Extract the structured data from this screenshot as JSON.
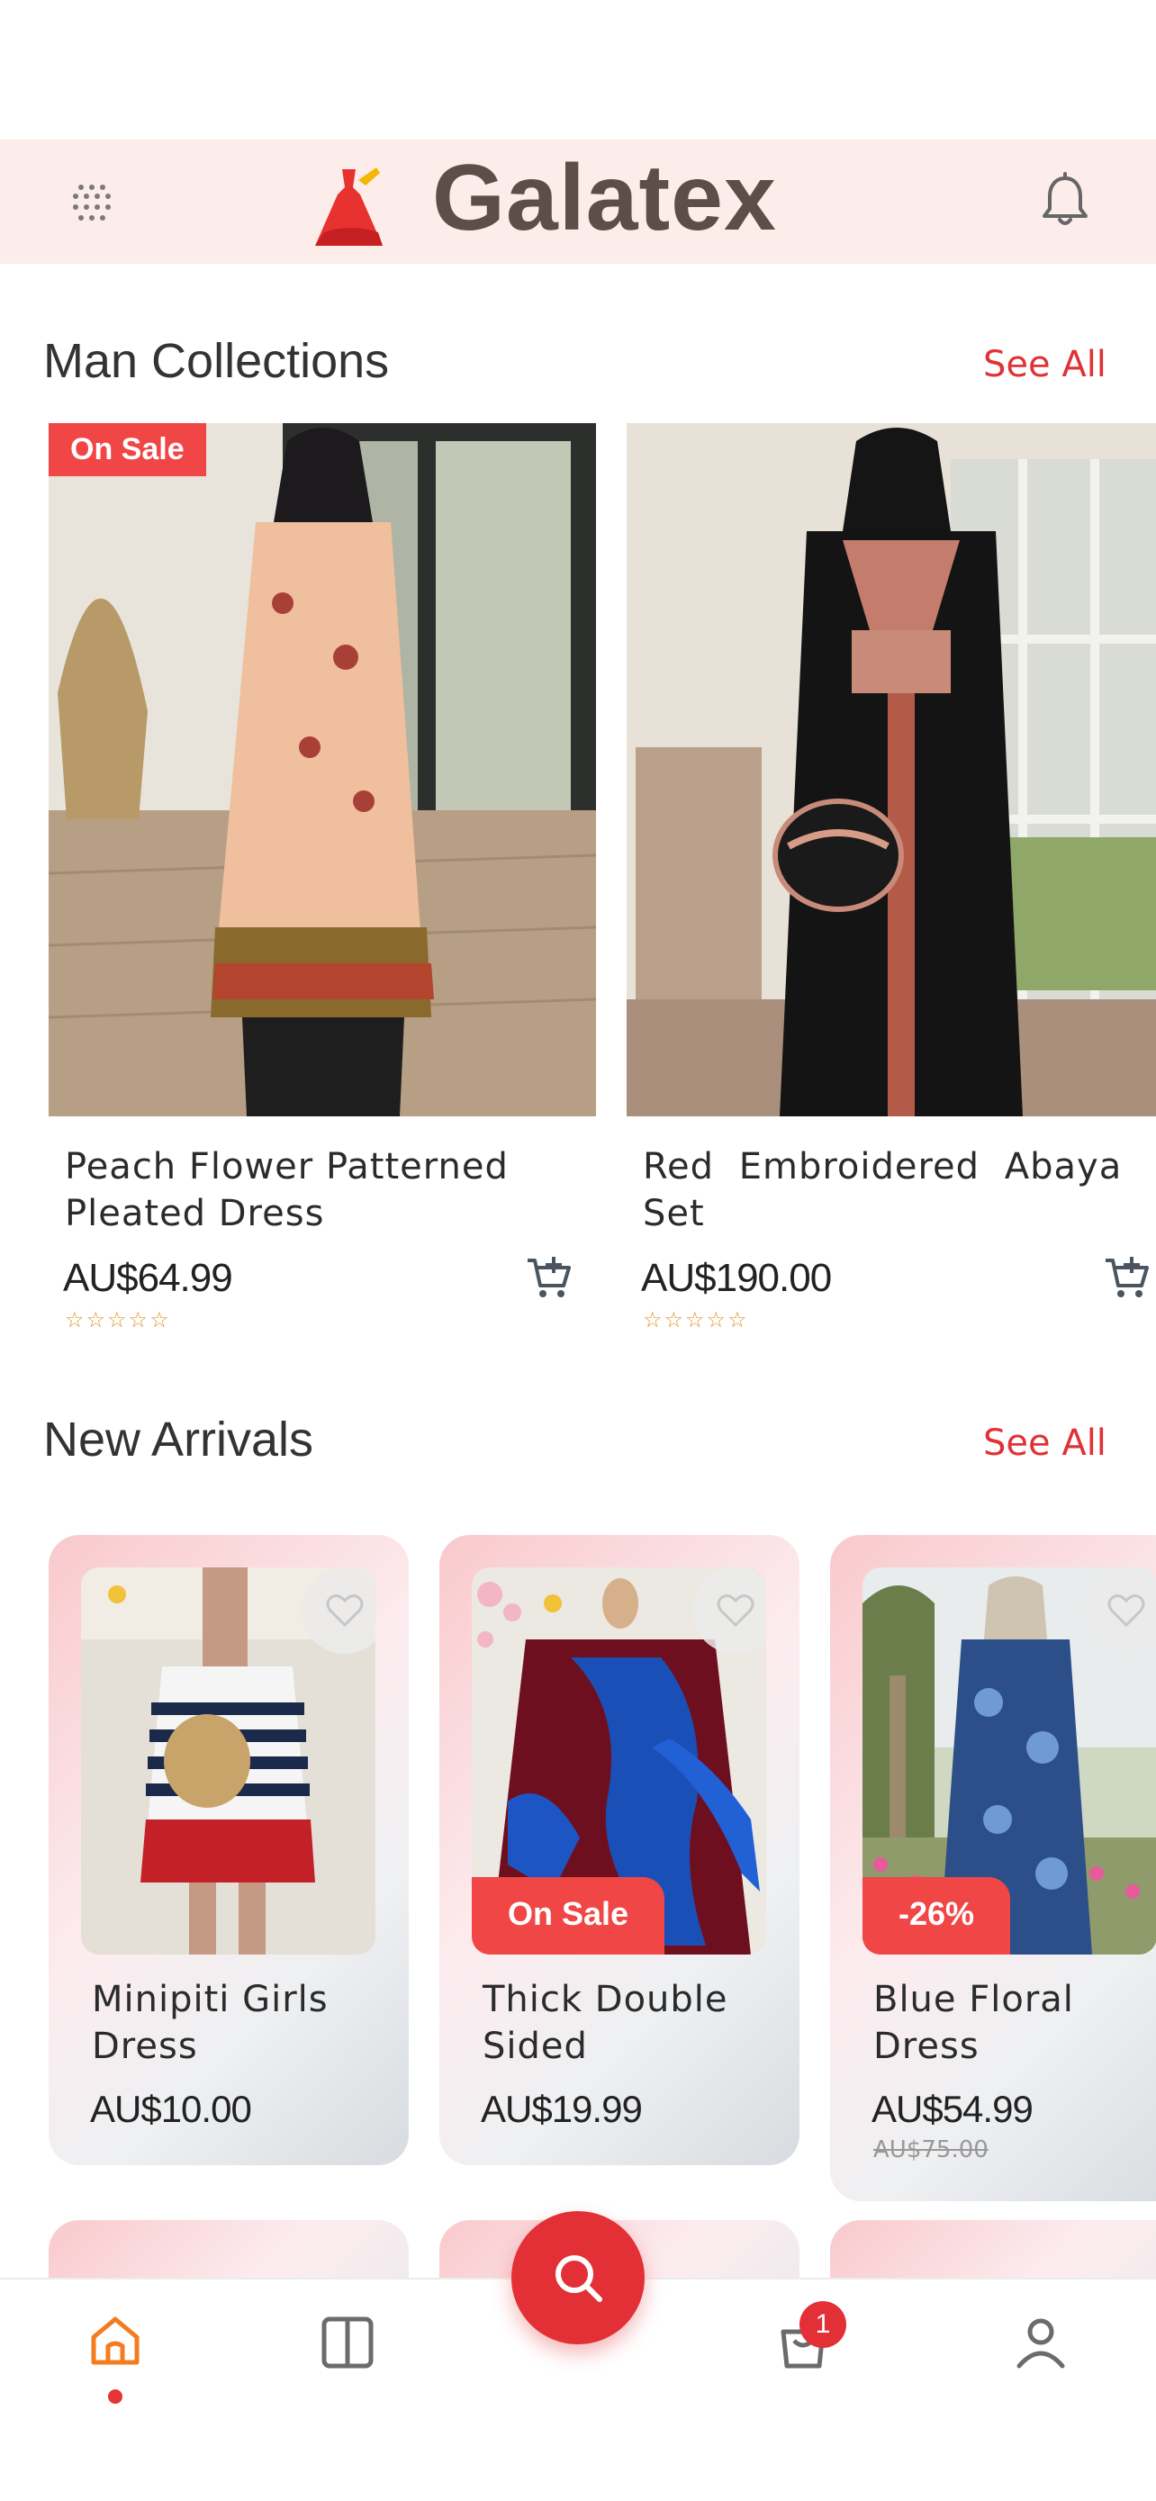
{
  "header": {
    "brand": "Galatex",
    "colors": {
      "bar": "#fcecea",
      "brand_text": "#5e4d49",
      "accent": "#e23036"
    }
  },
  "man_collections": {
    "title": "Man Collections",
    "see_all": "See All",
    "products": [
      {
        "badge": "On Sale",
        "name": "Peach Flower Patterned Pleated Dress",
        "price": "AU$64.99",
        "rating": 0,
        "stars": "☆☆☆☆☆"
      },
      {
        "badge": "",
        "name": "Red Embroidered Abaya Set",
        "price": "AU$190.00",
        "rating": 0,
        "stars": "☆☆☆☆☆"
      }
    ]
  },
  "new_arrivals": {
    "title": "New Arrivals",
    "see_all": "See All",
    "products": [
      {
        "badge": "",
        "name": "Minipiti Girls Dress",
        "price": "AU$10.00",
        "old_price": ""
      },
      {
        "badge": "On Sale",
        "name": "Thick Double Sided",
        "price": "AU$19.99",
        "old_price": ""
      },
      {
        "badge": "-26%",
        "name": "Blue Floral Dress",
        "price": "AU$54.99",
        "old_price": "AU$75.00"
      }
    ]
  },
  "tabbar": {
    "tabs": [
      "home-icon",
      "catalog-icon",
      "search-icon",
      "cart-icon",
      "profile-icon"
    ],
    "active": "home",
    "cart_count": "1"
  }
}
